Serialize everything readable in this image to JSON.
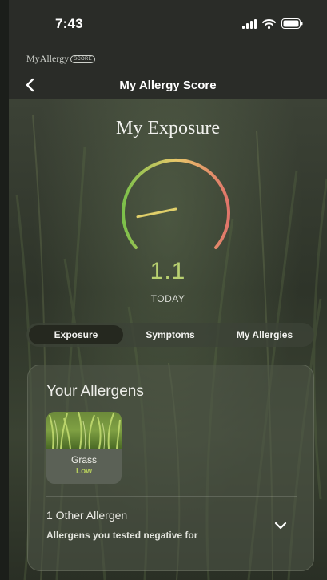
{
  "status_bar": {
    "time": "7:43",
    "icons": [
      "signal-icon",
      "wifi-icon",
      "battery-icon"
    ]
  },
  "brand": {
    "name": "MyAllergy",
    "badge": "SCORE"
  },
  "nav": {
    "back_icon": "chevron-left-icon",
    "title": "My Allergy Score"
  },
  "exposure": {
    "title": "My Exposure",
    "score": "1.1",
    "score_label": "TODAY",
    "gauge_level": 0.11
  },
  "tabs": [
    {
      "label": "Exposure",
      "active": true
    },
    {
      "label": "Symptoms",
      "active": false
    },
    {
      "label": "My Allergies",
      "active": false
    }
  ],
  "allergens_card": {
    "title": "Your Allergens",
    "items": [
      {
        "name": "Grass",
        "level": "Low"
      }
    ],
    "other": {
      "title": "1 Other Allergen",
      "subtitle": "Allergens you tested negative for",
      "expand_icon": "chevron-down-icon"
    }
  },
  "colors": {
    "score": "#b8d070",
    "level_low": "#b4cc5c",
    "gauge_start": "#7bc04a",
    "gauge_mid": "#e8c86a",
    "gauge_end": "#e0746a"
  }
}
